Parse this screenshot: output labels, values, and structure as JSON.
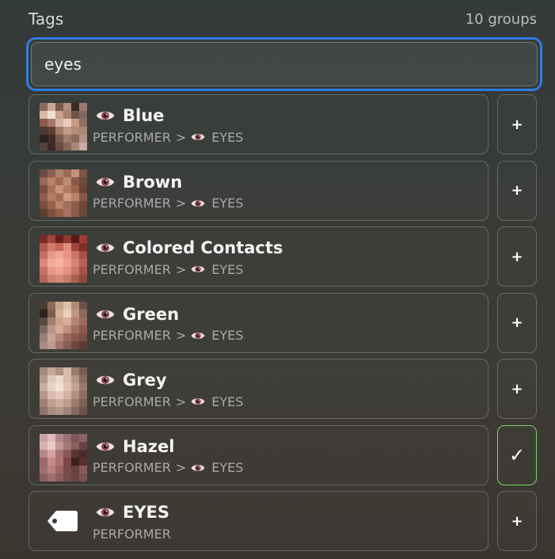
{
  "header": {
    "title": "Tags",
    "count": "10 groups"
  },
  "search": {
    "value": "eyes",
    "placeholder": ""
  },
  "colors": {
    "focus_border": "#2f7ce0",
    "selected_border": "#7ed36b"
  },
  "tags": [
    {
      "name": "Blue",
      "path_root": "PERFORMER",
      "path_sep": ">",
      "path_parent": "EYES",
      "has_parent": true,
      "thumbnail": "thumb",
      "action": "+",
      "selected": false,
      "thumb_colors": [
        "#8a6a5e",
        "#c9a894",
        "#7a5a4a",
        "#b08e7c",
        "#3a2a24",
        "#9a7a6a",
        "#d8b9a8",
        "#efe0d6",
        "#c6a08c",
        "#a88070",
        "#6e5448",
        "#7a6a62",
        "#8a5a4a",
        "#a47866",
        "#d2b3a3",
        "#e8cdbd",
        "#c89a88",
        "#8e6e62",
        "#4a3a32",
        "#5a3e34",
        "#a27a68",
        "#c49a8a",
        "#b78a7a",
        "#aa8676",
        "#2e2220",
        "#402c26",
        "#7a5a4e",
        "#a07a6a",
        "#8c6a5e",
        "#b4928a",
        "#55403a",
        "#3c2a26",
        "#6a4c42",
        "#886658",
        "#a4887c",
        "#c8aaa0"
      ]
    },
    {
      "name": "Brown",
      "path_root": "PERFORMER",
      "path_sep": ">",
      "path_parent": "EYES",
      "has_parent": true,
      "thumbnail": "thumb",
      "action": "+",
      "selected": false,
      "thumb_colors": [
        "#6a4a3e",
        "#8a6050",
        "#b0806a",
        "#9a6a56",
        "#c49078",
        "#7a5444",
        "#9a6a58",
        "#b88068",
        "#a06a52",
        "#c08c72",
        "#8a5a48",
        "#704a3c",
        "#7a4e40",
        "#a87058",
        "#c8957a",
        "#b07a62",
        "#9a6450",
        "#6a4436",
        "#8e5e4c",
        "#b27a62",
        "#a46c56",
        "#cc9a80",
        "#b6826a",
        "#8a5a48",
        "#7a4c3e",
        "#96604c",
        "#b8846c",
        "#a0705a",
        "#8c5e4c",
        "#6e4636",
        "#5e3e32",
        "#7a5040",
        "#945e4a",
        "#a87260",
        "#865a4a",
        "#6a4638"
      ]
    },
    {
      "name": "Colored Contacts",
      "path_root": "PERFORMER",
      "path_sep": ">",
      "path_parent": "EYES",
      "has_parent": true,
      "thumbnail": "thumb",
      "action": "+",
      "selected": false,
      "thumb_colors": [
        "#7a2a24",
        "#a0463c",
        "#6a1e1a",
        "#8a3a30",
        "#5a1a16",
        "#9a3e34",
        "#b05a4e",
        "#d07a6a",
        "#c4665a",
        "#e08e7e",
        "#a0483e",
        "#7a3028",
        "#c46e62",
        "#e49a8a",
        "#f0a898",
        "#e89484",
        "#cc7466",
        "#a45244",
        "#d88878",
        "#f2aa9a",
        "#f6b4a4",
        "#ecA090",
        "#d88474",
        "#b66254",
        "#c47264",
        "#e69888",
        "#f0a292",
        "#e49080",
        "#c87666",
        "#a45446",
        "#b06658",
        "#cc8070",
        "#d68a7a",
        "#c67a6a",
        "#a86050",
        "#8a4a3e"
      ]
    },
    {
      "name": "Green",
      "path_root": "PERFORMER",
      "path_sep": ">",
      "path_parent": "EYES",
      "has_parent": true,
      "thumbnail": "thumb",
      "action": "+",
      "selected": false,
      "thumb_colors": [
        "#4a3a30",
        "#8a6a58",
        "#c8a48c",
        "#e0c0a8",
        "#b08a76",
        "#6a5248",
        "#2e241e",
        "#7a5e50",
        "#d4b09a",
        "#ecd0bc",
        "#c09682",
        "#8a6a5c",
        "#5a4a40",
        "#a07e6c",
        "#caa28e",
        "#d6ae9a",
        "#b48470",
        "#9a6e5e",
        "#7a6a60",
        "#b8958a",
        "#d4ac98",
        "#c09080",
        "#a06e60",
        "#8a5a4c",
        "#9a7e74",
        "#c4a294",
        "#b48878",
        "#9c6a5c",
        "#8a5a4e",
        "#7a4e44",
        "#a88a80",
        "#bc9c90",
        "#a07468",
        "#8a5c52",
        "#6e483e",
        "#5a3c34"
      ]
    },
    {
      "name": "Grey",
      "path_root": "PERFORMER",
      "path_sep": ">",
      "path_parent": "EYES",
      "has_parent": true,
      "thumbnail": "thumb",
      "action": "+",
      "selected": false,
      "thumb_colors": [
        "#a48a7e",
        "#c4a89a",
        "#b0907e",
        "#d8bcae",
        "#9a7a6c",
        "#7a5e54",
        "#b89a8c",
        "#e0c8bc",
        "#ecd8cc",
        "#d6bcae",
        "#b89888",
        "#8a6c60",
        "#c8aca0",
        "#e8d2c6",
        "#f2e0d6",
        "#e0c6b8",
        "#c4a494",
        "#9a7a6c",
        "#b69688",
        "#d8bcae",
        "#e4cabc",
        "#d0b2a2",
        "#b08e7e",
        "#8e6e62",
        "#a08074",
        "#c0a090",
        "#ccae9e",
        "#bc9c8c",
        "#9c7a6c",
        "#7e6054",
        "#907266",
        "#aa8c7e",
        "#b4968a",
        "#a0827a",
        "#866a5e",
        "#6e544a"
      ]
    },
    {
      "name": "Hazel",
      "path_root": "PERFORMER",
      "path_sep": ">",
      "path_parent": "EYES",
      "has_parent": true,
      "thumbnail": "thumb",
      "action": "✓",
      "selected": true,
      "thumb_colors": [
        "#c8a0a0",
        "#e0bcbc",
        "#b08888",
        "#9a7070",
        "#7a5656",
        "#8a6464",
        "#d8b0b0",
        "#ecc8c8",
        "#c49898",
        "#a47878",
        "#8a5e5e",
        "#6a4444",
        "#b88888",
        "#d4a4a4",
        "#a87474",
        "#8a5656",
        "#5a3434",
        "#4a2a2a",
        "#9a6a6a",
        "#c48a8a",
        "#b07070",
        "#7a4848",
        "#3a1e1e",
        "#5a3030",
        "#a07070",
        "#b88282",
        "#9e6464",
        "#7a4a4a",
        "#6a3e3e",
        "#8a5a5a",
        "#8a5e5e",
        "#a07070",
        "#8e5e5e",
        "#7a4e4e",
        "#6a4444",
        "#7a5252"
      ]
    },
    {
      "name": "EYES",
      "path_root": "PERFORMER",
      "path_sep": "",
      "path_parent": "",
      "has_parent": false,
      "thumbnail": "tag-icon",
      "action": "+",
      "selected": false,
      "thumb_colors": []
    }
  ]
}
